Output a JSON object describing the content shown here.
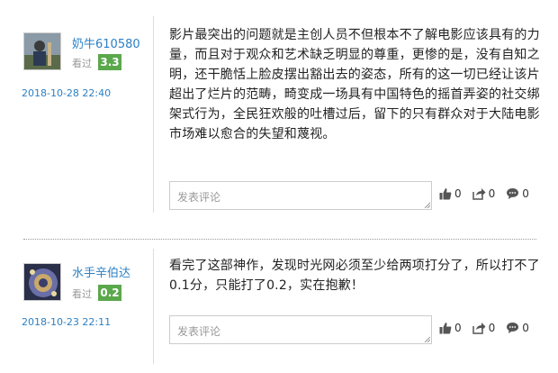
{
  "reviews": [
    {
      "username": "奶牛610580",
      "seen_label": "看过",
      "score": "3.3",
      "date": "2018-10-28 22:40",
      "text": "影片最突出的问题就是主创人员不但根本不了解电影应该具有的力量，而且对于观众和艺术缺乏明显的尊重，更惨的是，没有自知之明，还干脆恬上脸皮摆出豁出去的姿态，所有的这一切已经让该片超出了烂片的范畴，畸变成一场具有中国特色的摇首弄姿的社交绑架式行为，全民狂欢般的吐槽过后，留下的只有群众对于大陆电影市场难以愈合的失望和蔑视。",
      "comment_placeholder": "发表评论",
      "likes": "0",
      "shares": "0",
      "comments": "0"
    },
    {
      "username": "水手辛伯达",
      "seen_label": "看过",
      "score": "0.2",
      "date": "2018-10-23 22:11",
      "text": "看完了这部神作，发现时光网必须至少给两项打分了，所以打不了0.1分，只能打了0.2，实在抱歉！",
      "comment_placeholder": "发表评论",
      "likes": "0",
      "shares": "0",
      "comments": "0"
    }
  ],
  "colors": {
    "username": "#2b80c4",
    "score_badge": "#5ba84c",
    "date": "#2b80c4"
  },
  "icons": [
    "avatar",
    "thumbs-up-icon",
    "share-icon",
    "comment-bubble-icon"
  ]
}
